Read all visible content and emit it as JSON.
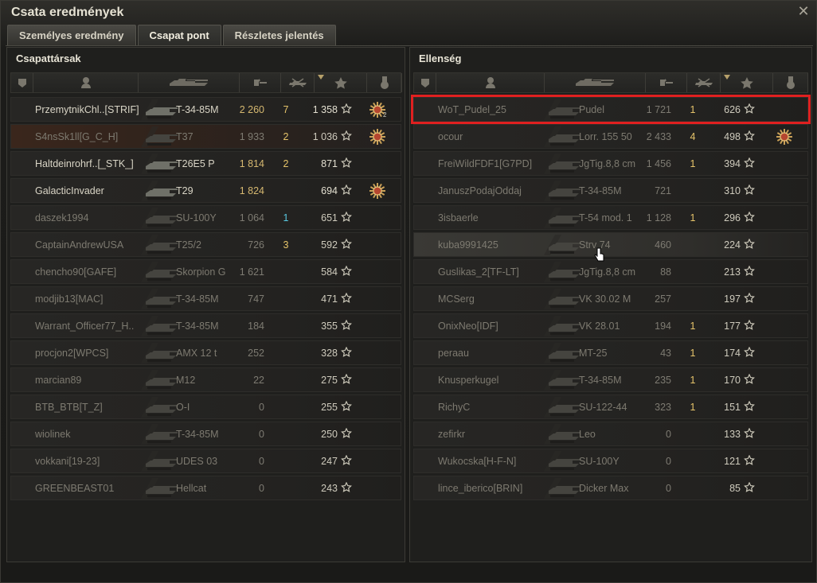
{
  "window": {
    "title": "Csata eredmények"
  },
  "tabs": [
    {
      "label": "Személyes eredmény"
    },
    {
      "label": "Csapat pont"
    },
    {
      "label": "Részletes jelentés"
    }
  ],
  "colors": {
    "accent": "#e02020",
    "gold": "#d6b870",
    "blue": "#58c8e0"
  },
  "left": {
    "title": "Csapattársak",
    "rows": [
      {
        "name": "PrzemytnikChl..[STRIF]",
        "vehicle": "T-34-85M",
        "exp": "2 260",
        "kills": "7",
        "score": "1 358",
        "medal": "2",
        "alive": true,
        "exp_gold": true,
        "kills_color": "gold"
      },
      {
        "name": "S4nsSk1ll[G_C_H]",
        "vehicle": "T37",
        "exp": "1 933",
        "kills": "2",
        "score": "1 036",
        "medal": "1",
        "alive": false,
        "self": true,
        "kills_color": "gold"
      },
      {
        "name": "Haltdeinrohrf..[_STK_]",
        "vehicle": "T26E5 P",
        "exp": "1 814",
        "kills": "2",
        "score": "871",
        "alive": true,
        "exp_gold": true,
        "kills_color": "gold"
      },
      {
        "name": "GalacticInvader",
        "vehicle": "T29",
        "exp": "1 824",
        "kills": "",
        "score": "694",
        "medal": "1",
        "alive": true,
        "exp_gold": true
      },
      {
        "name": "daszek1994",
        "vehicle": "SU-100Y",
        "exp": "1 064",
        "kills": "1",
        "score": "651",
        "alive": false,
        "kills_color": "blue"
      },
      {
        "name": "CaptainAndrewUSA",
        "vehicle": "T25/2",
        "exp": "726",
        "kills": "3",
        "score": "592",
        "alive": false,
        "kills_color": "gold"
      },
      {
        "name": "chencho90[GAFE]",
        "vehicle": "Skorpion G",
        "exp": "1 621",
        "kills": "",
        "score": "584",
        "alive": false
      },
      {
        "name": "modjib13[MAC]",
        "vehicle": "T-34-85M",
        "exp": "747",
        "kills": "",
        "score": "471",
        "alive": false
      },
      {
        "name": "Warrant_Officer77_H..",
        "vehicle": "T-34-85M",
        "exp": "184",
        "kills": "",
        "score": "355",
        "alive": false
      },
      {
        "name": "procjon2[WPCS]",
        "vehicle": "AMX 12 t",
        "exp": "252",
        "kills": "",
        "score": "328",
        "alive": false
      },
      {
        "name": "marcian89",
        "vehicle": "M12",
        "exp": "22",
        "kills": "",
        "score": "275",
        "alive": false
      },
      {
        "name": "BTB_BTB[T_Z]",
        "vehicle": "O-I",
        "exp": "0",
        "kills": "",
        "score": "255",
        "alive": false
      },
      {
        "name": "wiolinek",
        "vehicle": "T-34-85M",
        "exp": "0",
        "kills": "",
        "score": "250",
        "alive": false
      },
      {
        "name": "vokkani[19-23]",
        "vehicle": "UDES 03",
        "exp": "0",
        "kills": "",
        "score": "247",
        "alive": false
      },
      {
        "name": "GREENBEAST01",
        "vehicle": "Hellcat",
        "exp": "0",
        "kills": "",
        "score": "243",
        "alive": false
      }
    ]
  },
  "right": {
    "title": "Ellenség",
    "rows": [
      {
        "name": "WoT_Pudel_25",
        "vehicle": "Pudel",
        "exp": "1 721",
        "kills": "1",
        "score": "626",
        "alive": false,
        "highlight": true,
        "kills_color": "gold"
      },
      {
        "name": "ocour",
        "vehicle": "Lorr. 155 50",
        "exp": "2 433",
        "kills": "4",
        "score": "498",
        "medal": "1",
        "alive": false,
        "kills_color": "gold"
      },
      {
        "name": "FreiWildFDF1[G7PD]",
        "vehicle": "JgTig.8,8 cm",
        "exp": "1 456",
        "kills": "1",
        "score": "394",
        "alive": false,
        "kills_color": "gold"
      },
      {
        "name": "JanuszPodajOddaj",
        "vehicle": "T-34-85M",
        "exp": "721",
        "kills": "",
        "score": "310",
        "alive": false
      },
      {
        "name": "3isbaerle",
        "vehicle": "T-54 mod. 1",
        "exp": "1 128",
        "kills": "1",
        "score": "296",
        "alive": false,
        "kills_color": "gold"
      },
      {
        "name": "kuba9991425",
        "vehicle": "Strv 74",
        "exp": "460",
        "kills": "",
        "score": "224",
        "alive": false,
        "hover": true
      },
      {
        "name": "Guslikas_2[TF-LT]",
        "vehicle": "JgTig.8,8 cm",
        "exp": "88",
        "kills": "",
        "score": "213",
        "alive": false
      },
      {
        "name": "MCSerg",
        "vehicle": "VK 30.02 M",
        "exp": "257",
        "kills": "",
        "score": "197",
        "alive": false
      },
      {
        "name": "OnixNeo[IDF]",
        "vehicle": "VK 28.01",
        "exp": "194",
        "kills": "1",
        "score": "177",
        "alive": false,
        "kills_color": "gold"
      },
      {
        "name": "peraau",
        "vehicle": "MT-25",
        "exp": "43",
        "kills": "1",
        "score": "174",
        "alive": false,
        "kills_color": "gold"
      },
      {
        "name": "Knusperkugel",
        "vehicle": "T-34-85M",
        "exp": "235",
        "kills": "1",
        "score": "170",
        "alive": false,
        "kills_color": "gold"
      },
      {
        "name": "RichyC",
        "vehicle": "SU-122-44",
        "exp": "323",
        "kills": "1",
        "score": "151",
        "alive": false,
        "kills_color": "gold"
      },
      {
        "name": "zefirkr",
        "vehicle": "Leo",
        "exp": "0",
        "kills": "",
        "score": "133",
        "alive": false
      },
      {
        "name": "Wukocska[H-F-N]",
        "vehicle": "SU-100Y",
        "exp": "0",
        "kills": "",
        "score": "121",
        "alive": false
      },
      {
        "name": "lince_iberico[BRIN]",
        "vehicle": "Dicker Max",
        "exp": "0",
        "kills": "",
        "score": "85",
        "alive": false
      }
    ]
  }
}
